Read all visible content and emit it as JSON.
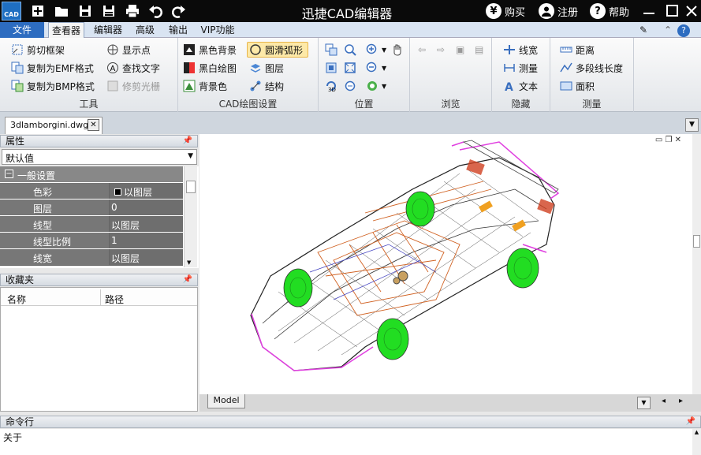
{
  "app": {
    "title": "迅捷CAD编辑器",
    "logo_text": "CAD"
  },
  "title_actions": {
    "buy": "购买",
    "register": "注册",
    "help": "帮助",
    "buy_symbol": "¥",
    "help_symbol": "?"
  },
  "menu": {
    "file": "文件",
    "tabs": [
      "查看器",
      "编辑器",
      "高级",
      "输出",
      "VIP功能"
    ]
  },
  "ribbon": {
    "tools": {
      "label": "工具",
      "items": [
        "剪切框架",
        "复制为EMF格式",
        "复制为BMP格式",
        "显示点",
        "查找文字",
        "修剪光栅"
      ]
    },
    "cad_settings": {
      "label": "CAD绘图设置",
      "items": [
        "黑色背景",
        "黑白绘图",
        "背景色",
        "圆滑弧形",
        "图层",
        "结构"
      ]
    },
    "position": {
      "label": "位置"
    },
    "browse": {
      "label": "浏览"
    },
    "hide": {
      "label": "隐藏",
      "items": [
        "线宽",
        "测量",
        "文本"
      ]
    },
    "measure": {
      "label": "测量",
      "items": [
        "距离",
        "多段线长度",
        "面积"
      ]
    }
  },
  "doc_tab": {
    "name": "3dlamborgini.dwg",
    "close": "✕"
  },
  "properties": {
    "title": "属性",
    "dropdown": "默认值",
    "group": "一般设置",
    "rows": [
      {
        "key": "色彩",
        "value": "以图层"
      },
      {
        "key": "图层",
        "value": "0"
      },
      {
        "key": "线型",
        "value": "以图层"
      },
      {
        "key": "线型比例",
        "value": "1"
      },
      {
        "key": "线宽",
        "value": "以图层"
      }
    ]
  },
  "favorites": {
    "title": "收藏夹",
    "columns": [
      "名称",
      "路径"
    ]
  },
  "model_tab": "Model",
  "command": {
    "title": "命令行",
    "text": "关于"
  },
  "colors": {
    "accent": "#2d6cc0",
    "titlebar": "#0a0a0a",
    "wheel": "#22dd22",
    "magenta": "#e040e0",
    "orange": "#d06020"
  }
}
